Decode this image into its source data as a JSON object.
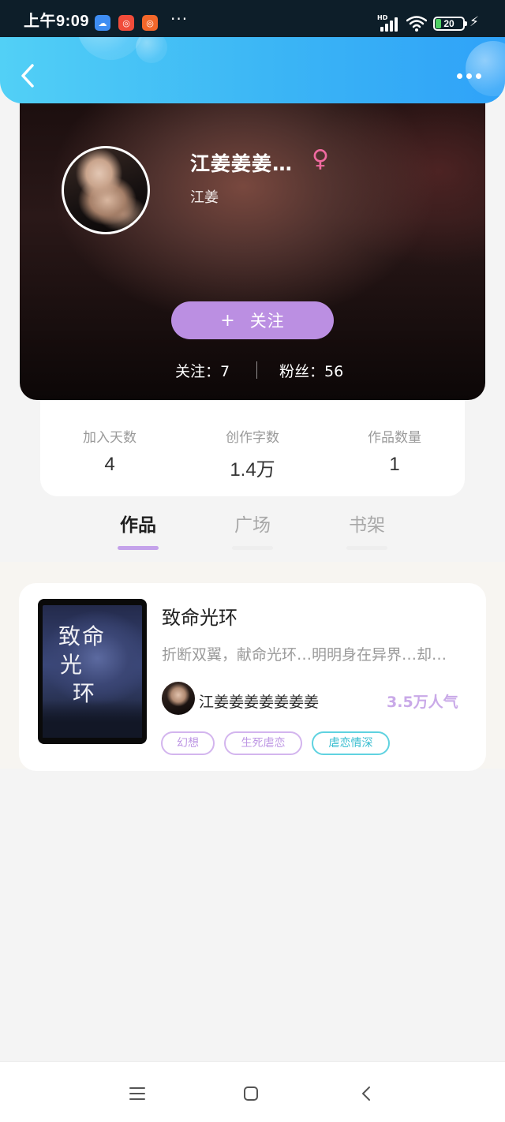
{
  "status_bar": {
    "time": "上午9:09",
    "more": "···",
    "network": "HD",
    "battery": "20"
  },
  "nav": {
    "back_icon": "chevron-left-icon",
    "more_icon": "more-dots-icon"
  },
  "profile": {
    "nickname": "江姜姜姜…",
    "gender_icon": "female-icon",
    "gender_symbol": "♀",
    "username": "江姜",
    "follow_button": {
      "plus": "+",
      "label": "关注"
    },
    "following": "关注：7",
    "fans": "粉丝：56"
  },
  "stats": [
    {
      "label": "加入天数",
      "value": "4"
    },
    {
      "label": "创作字数",
      "value": "1.4万"
    },
    {
      "label": "作品数量",
      "value": "1"
    }
  ],
  "tabs": [
    {
      "label": "作品",
      "active": true
    },
    {
      "label": "广场",
      "active": false
    },
    {
      "label": "书架",
      "active": false
    }
  ],
  "book": {
    "title": "致命光环",
    "description": "折断双翼，献命光环…明明身在异界…却…",
    "cover_title_lines": [
      "致命",
      "光",
      "环"
    ],
    "author": "江姜姜姜姜姜姜姜",
    "popularity": "3.5万人气",
    "tags": [
      {
        "label": "幻想",
        "color": "#be97e4"
      },
      {
        "label": "生死虐恋",
        "color": "#be97e4"
      },
      {
        "label": "虐恋情深",
        "color": "#35bccf"
      }
    ]
  },
  "colors": {
    "header_gradient_start": "#52d0f6",
    "header_gradient_end": "#2fa2f8",
    "follow_button": "#bb8fe2",
    "tab_active_underline": "#c4a2ea",
    "gender_pink": "#f06aa0"
  },
  "bottom_nav": {
    "menu_icon": "menu-icon",
    "home_icon": "home-square-icon",
    "back_icon": "back-triangle-icon"
  }
}
